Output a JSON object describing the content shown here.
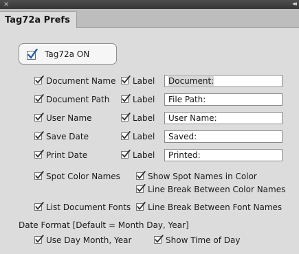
{
  "panel": {
    "close_glyph": "×",
    "collapse_glyph": "◂◂",
    "tab_label": "Tag72a Prefs"
  },
  "master": {
    "label": "Tag72a ON",
    "checked": true
  },
  "rows": [
    {
      "item": "Document Name",
      "label_text": "Label",
      "value": "Document:"
    },
    {
      "item": "Document Path",
      "label_text": "Label",
      "value": "File Path:"
    },
    {
      "item": "User Name",
      "label_text": "Label",
      "value": "User Name:"
    },
    {
      "item": "Save Date",
      "label_text": "Label",
      "value": "Saved:"
    },
    {
      "item": "Print Date",
      "label_text": "Label",
      "value": "Printed:"
    }
  ],
  "options": {
    "spot_color_names": "Spot Color Names",
    "show_spot_names": "Show Spot Names in Color",
    "line_break_color": "Line Break Between Color Names",
    "list_document_fonts": "List Document Fonts",
    "line_break_font": "Line Break Between Font Names"
  },
  "date_format": {
    "heading": "Date Format [Default = Month Day, Year]",
    "use_day_month_year": "Use Day Month, Year",
    "show_time_of_day": "Show Time of Day"
  },
  "colors": {
    "check": "#2b2b2b",
    "master_check": "#1f5fb8",
    "panel_bg": "#dcdcdc"
  }
}
